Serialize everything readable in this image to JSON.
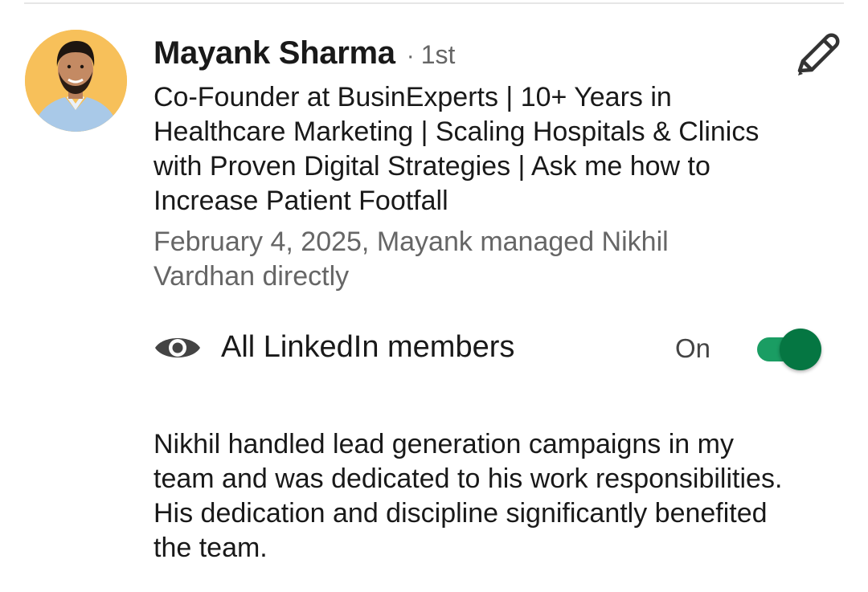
{
  "recommender": {
    "name": "Mayank Sharma",
    "separator": "·",
    "degree": "1st",
    "headline": "Co-Founder at BusinExperts | 10+ Years in Healthcare Marketing | Scaling Hospitals & Clinics with Proven Digital Strategies | Ask me how to Increase Patient Footfall",
    "relationship": "February 4, 2025, Mayank managed Nikhil Vardhan directly",
    "avatar_icon": "profile-photo",
    "avatar_bg_color": "#f7c05a"
  },
  "edit_icon": "pencil-icon",
  "visibility": {
    "icon": "eye-icon",
    "label": "All LinkedIn members",
    "state_text": "On",
    "toggle_on": true,
    "toggle_color": "#057642"
  },
  "recommendation_text": "Nikhil handled lead generation campaigns in my team and was dedicated to his work responsibilities. His dedication and discipline significantly benefited the team."
}
